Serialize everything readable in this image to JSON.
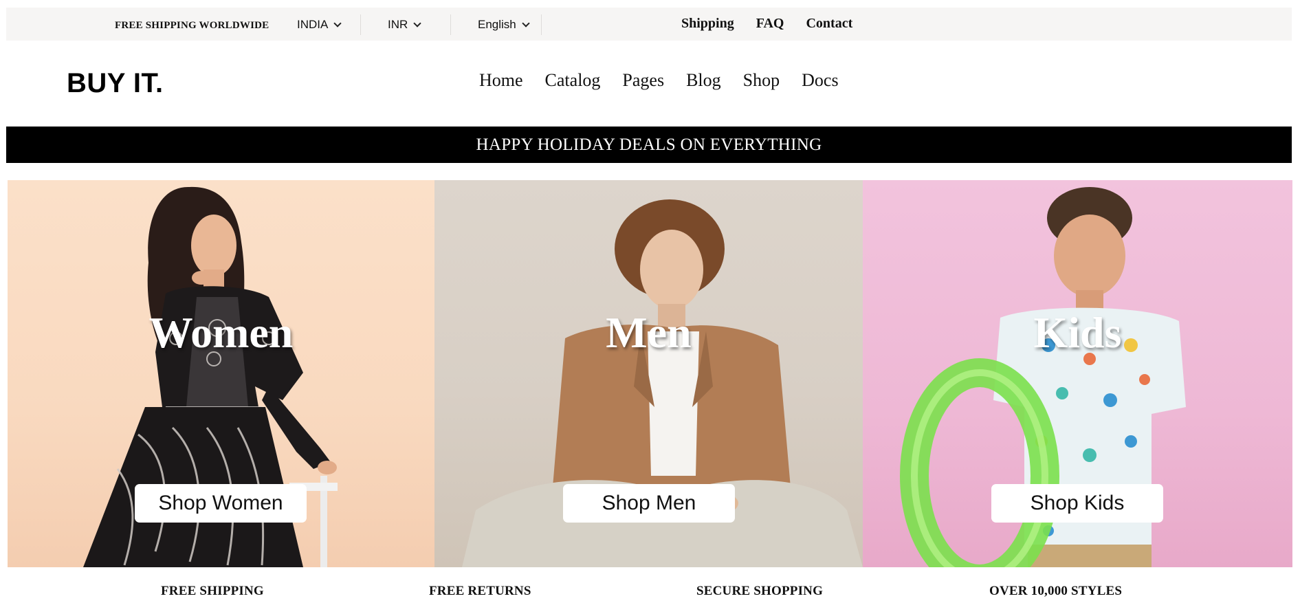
{
  "topbar": {
    "shipping_note": "FREE SHIPPING WORLDWIDE",
    "country": "INDIA",
    "currency": "INR",
    "language": "English",
    "links": [
      "Shipping",
      "FAQ",
      "Contact"
    ]
  },
  "header": {
    "logo": "BUY IT.",
    "nav": [
      "Home",
      "Catalog",
      "Pages",
      "Blog",
      "Shop",
      "Docs"
    ]
  },
  "announcement": "HAPPY HOLIDAY DEALS ON EVERYTHING",
  "hero": [
    {
      "title": "Women",
      "button": "Shop Women"
    },
    {
      "title": "Men",
      "button": "Shop Men"
    },
    {
      "title": "Kids",
      "button": "Shop Kids"
    }
  ],
  "features": [
    "FREE SHIPPING",
    "FREE RETURNS",
    "SECURE SHOPPING",
    "OVER 10,000 STYLES"
  ],
  "colors": {
    "topbar_bg": "#f6f5f4",
    "announce_bg": "#000000",
    "women_bg": "#fbe0c9",
    "men_bg": "#ddd5cc",
    "kids_bg": "#f2c3dd"
  }
}
